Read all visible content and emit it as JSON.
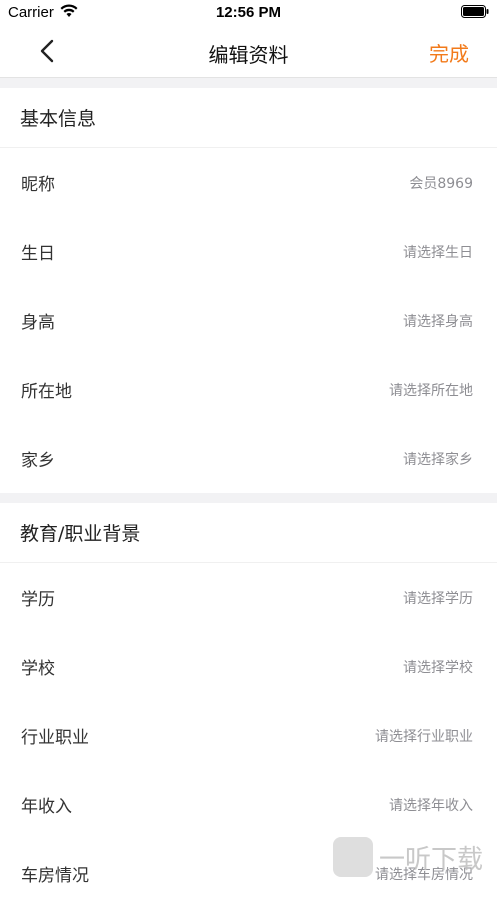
{
  "status_bar": {
    "carrier": "Carrier",
    "time": "12:56 PM"
  },
  "nav": {
    "title": "编辑资料",
    "done_label": "完成",
    "accent_color": "#f27a1a"
  },
  "sections": [
    {
      "title": "基本信息",
      "rows": [
        {
          "label": "昵称",
          "value": "会员8969"
        },
        {
          "label": "生日",
          "value": "请选择生日"
        },
        {
          "label": "身高",
          "value": "请选择身高"
        },
        {
          "label": "所在地",
          "value": "请选择所在地"
        },
        {
          "label": "家乡",
          "value": "请选择家乡"
        }
      ]
    },
    {
      "title": "教育/职业背景",
      "rows": [
        {
          "label": "学历",
          "value": "请选择学历"
        },
        {
          "label": "学校",
          "value": "请选择学校"
        },
        {
          "label": "行业职业",
          "value": "请选择行业职业"
        },
        {
          "label": "年收入",
          "value": "请选择年收入"
        },
        {
          "label": "车房情况",
          "value": "请选择车房情况"
        }
      ]
    }
  ],
  "watermark": {
    "text": "一听下载"
  }
}
